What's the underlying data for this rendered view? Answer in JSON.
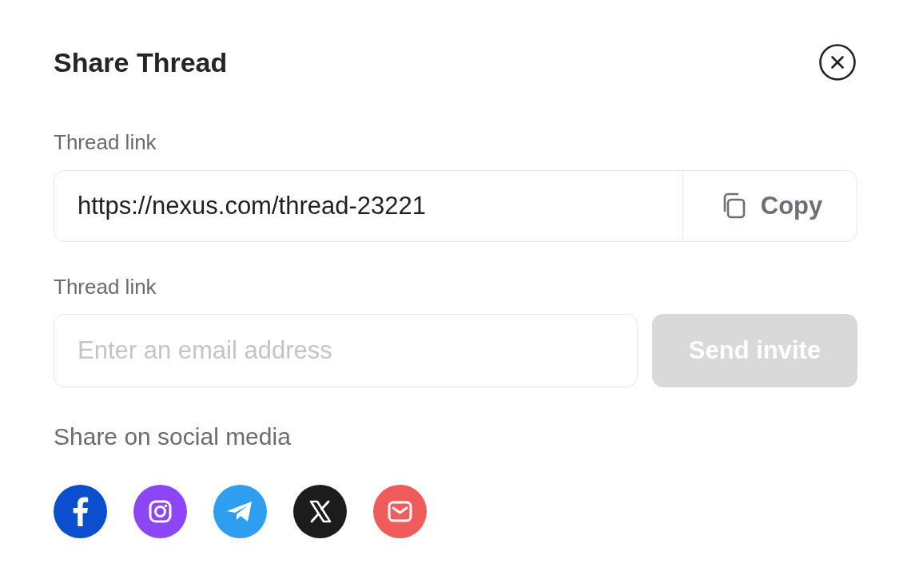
{
  "title": "Share Thread",
  "link_section": {
    "label": "Thread link",
    "url": "https://nexus.com/thread-23221",
    "copy_button": "Copy"
  },
  "invite_section": {
    "label": "Thread link",
    "placeholder": "Enter an email address",
    "send_button": {
      "label": "Send invite",
      "disabled": true
    }
  },
  "social": {
    "label": "Share on social media",
    "items": [
      {
        "kind": "facebook",
        "color": "#0b4fcf"
      },
      {
        "kind": "instagram",
        "color": "#8d46f6"
      },
      {
        "kind": "telegram",
        "color": "#2e9ef0"
      },
      {
        "kind": "x",
        "color": "#1c1c1c"
      },
      {
        "kind": "email",
        "color": "#f05c5c"
      }
    ]
  }
}
